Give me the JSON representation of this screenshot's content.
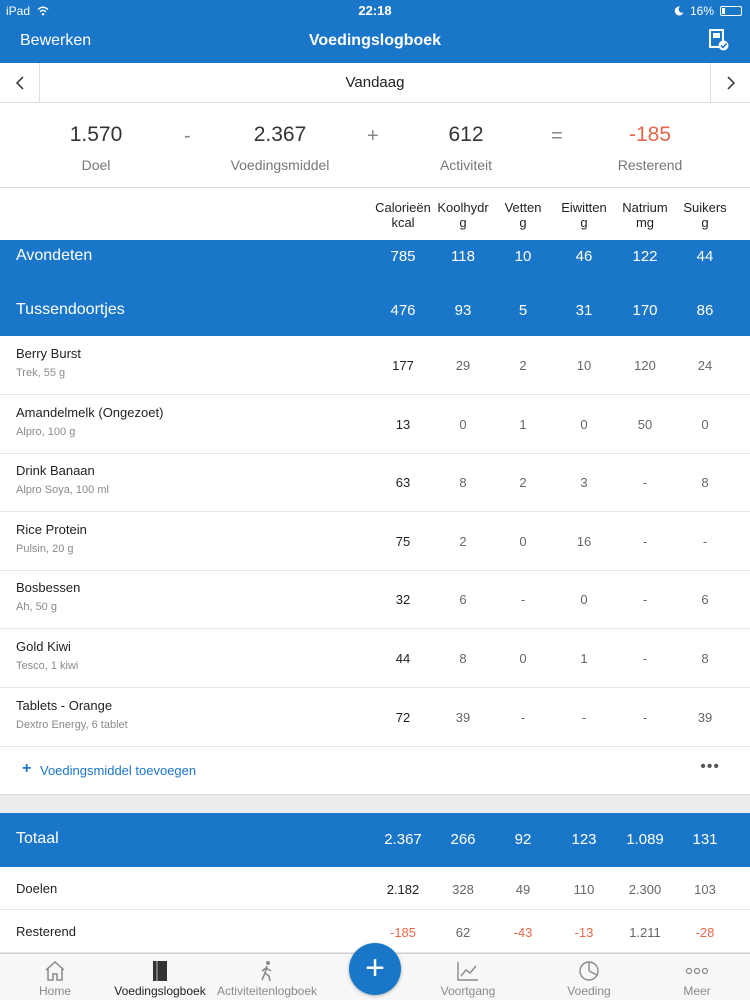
{
  "status": {
    "device": "iPad",
    "time": "22:18",
    "battery": "16%",
    "battery_level": 0.16
  },
  "nav": {
    "edit": "Bewerken",
    "title": "Voedingslogboek"
  },
  "date": {
    "label": "Vandaag"
  },
  "equation": {
    "goal": {
      "value": "1.570",
      "label": "Doel"
    },
    "minus": "-",
    "food": {
      "value": "2.367",
      "label": "Voedingsmiddel"
    },
    "plus": "+",
    "activity": {
      "value": "612",
      "label": "Activiteit"
    },
    "equals": "=",
    "remaining": {
      "value": "-185",
      "label": "Resterend"
    }
  },
  "columns": [
    {
      "name": "Calorieën",
      "unit": "kcal"
    },
    {
      "name": "Koolhydr",
      "unit": "g"
    },
    {
      "name": "Vetten",
      "unit": "g"
    },
    {
      "name": "Eiwitten",
      "unit": "g"
    },
    {
      "name": "Natrium",
      "unit": "mg"
    },
    {
      "name": "Suikers",
      "unit": "g"
    }
  ],
  "meals": [
    {
      "name": "Avondeten",
      "values": [
        "785",
        "118",
        "10",
        "46",
        "122",
        "44"
      ]
    },
    {
      "name": "Tussendoortjes",
      "values": [
        "476",
        "93",
        "5",
        "31",
        "170",
        "86"
      ]
    }
  ],
  "foods": [
    {
      "name": "Berry Burst",
      "desc": "Trek, 55 g",
      "values": [
        "177",
        "29",
        "2",
        "10",
        "120",
        "24"
      ]
    },
    {
      "name": "Amandelmelk (Ongezoet)",
      "desc": "Alpro, 100 g",
      "values": [
        "13",
        "0",
        "1",
        "0",
        "50",
        "0"
      ]
    },
    {
      "name": "Drink Banaan",
      "desc": "Alpro Soya, 100 ml",
      "values": [
        "63",
        "8",
        "2",
        "3",
        "-",
        "8"
      ]
    },
    {
      "name": "Rice Protein",
      "desc": "Pulsin, 20 g",
      "values": [
        "75",
        "2",
        "0",
        "16",
        "-",
        "-"
      ]
    },
    {
      "name": "Bosbessen",
      "desc": "Ah, 50 g",
      "values": [
        "32",
        "6",
        "-",
        "0",
        "-",
        "6"
      ]
    },
    {
      "name": "Gold Kiwi",
      "desc": "Tesco, 1 kiwi",
      "values": [
        "44",
        "8",
        "0",
        "1",
        "-",
        "8"
      ]
    },
    {
      "name": "Tablets - Orange",
      "desc": "Dextro Energy, 6 tablet",
      "values": [
        "72",
        "39",
        "-",
        "-",
        "-",
        "39"
      ]
    }
  ],
  "add": {
    "plus": "+",
    "label": "Voedingsmiddel toevoegen",
    "more": "•••"
  },
  "totals": {
    "name": "Totaal",
    "values": [
      "2.367",
      "266",
      "92",
      "123",
      "1.089",
      "131"
    ]
  },
  "goals": {
    "name": "Doelen",
    "values": [
      "2.182",
      "328",
      "49",
      "110",
      "2.300",
      "103"
    ]
  },
  "remaining": {
    "name": "Resterend",
    "values": [
      "-185",
      "62",
      "-43",
      "-13",
      "1.211",
      "-28"
    ]
  },
  "tabs": {
    "home": "Home",
    "foodlog": "Voedingslogboek",
    "activity": "Activiteitenlogboek",
    "add": "+",
    "progress": "Voortgang",
    "nutrition": "Voeding",
    "more": "Meer"
  },
  "colors": {
    "accent": "#1a76c8",
    "negative": "#e8674a"
  },
  "icons": [
    "wifi-icon",
    "moon-icon",
    "battery-icon",
    "diary-export-icon",
    "chevron-left-icon",
    "chevron-right-icon",
    "home-icon",
    "book-icon",
    "walking-icon",
    "chart-icon",
    "pie-icon",
    "more-dots-icon"
  ]
}
